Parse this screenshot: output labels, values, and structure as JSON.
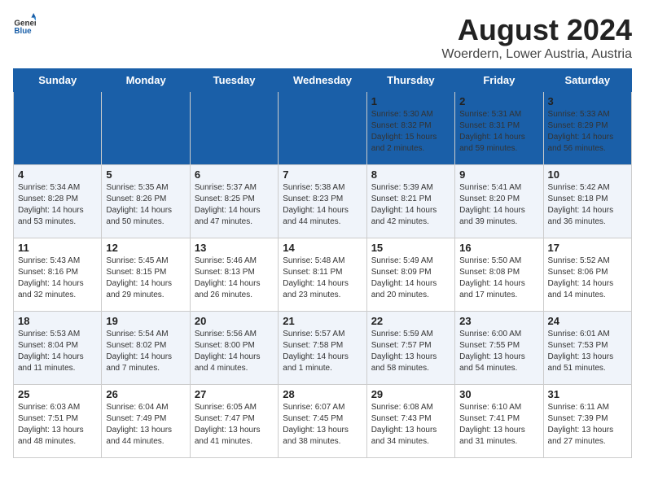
{
  "logo": {
    "text_general": "General",
    "text_blue": "Blue"
  },
  "title": "August 2024",
  "subtitle": "Woerdern, Lower Austria, Austria",
  "days": [
    "Sunday",
    "Monday",
    "Tuesday",
    "Wednesday",
    "Thursday",
    "Friday",
    "Saturday"
  ],
  "weeks": [
    [
      {
        "date": "",
        "info": ""
      },
      {
        "date": "",
        "info": ""
      },
      {
        "date": "",
        "info": ""
      },
      {
        "date": "",
        "info": ""
      },
      {
        "date": "1",
        "info": "Sunrise: 5:30 AM\nSunset: 8:32 PM\nDaylight: 15 hours\nand 2 minutes."
      },
      {
        "date": "2",
        "info": "Sunrise: 5:31 AM\nSunset: 8:31 PM\nDaylight: 14 hours\nand 59 minutes."
      },
      {
        "date": "3",
        "info": "Sunrise: 5:33 AM\nSunset: 8:29 PM\nDaylight: 14 hours\nand 56 minutes."
      }
    ],
    [
      {
        "date": "4",
        "info": "Sunrise: 5:34 AM\nSunset: 8:28 PM\nDaylight: 14 hours\nand 53 minutes."
      },
      {
        "date": "5",
        "info": "Sunrise: 5:35 AM\nSunset: 8:26 PM\nDaylight: 14 hours\nand 50 minutes."
      },
      {
        "date": "6",
        "info": "Sunrise: 5:37 AM\nSunset: 8:25 PM\nDaylight: 14 hours\nand 47 minutes."
      },
      {
        "date": "7",
        "info": "Sunrise: 5:38 AM\nSunset: 8:23 PM\nDaylight: 14 hours\nand 44 minutes."
      },
      {
        "date": "8",
        "info": "Sunrise: 5:39 AM\nSunset: 8:21 PM\nDaylight: 14 hours\nand 42 minutes."
      },
      {
        "date": "9",
        "info": "Sunrise: 5:41 AM\nSunset: 8:20 PM\nDaylight: 14 hours\nand 39 minutes."
      },
      {
        "date": "10",
        "info": "Sunrise: 5:42 AM\nSunset: 8:18 PM\nDaylight: 14 hours\nand 36 minutes."
      }
    ],
    [
      {
        "date": "11",
        "info": "Sunrise: 5:43 AM\nSunset: 8:16 PM\nDaylight: 14 hours\nand 32 minutes."
      },
      {
        "date": "12",
        "info": "Sunrise: 5:45 AM\nSunset: 8:15 PM\nDaylight: 14 hours\nand 29 minutes."
      },
      {
        "date": "13",
        "info": "Sunrise: 5:46 AM\nSunset: 8:13 PM\nDaylight: 14 hours\nand 26 minutes."
      },
      {
        "date": "14",
        "info": "Sunrise: 5:48 AM\nSunset: 8:11 PM\nDaylight: 14 hours\nand 23 minutes."
      },
      {
        "date": "15",
        "info": "Sunrise: 5:49 AM\nSunset: 8:09 PM\nDaylight: 14 hours\nand 20 minutes."
      },
      {
        "date": "16",
        "info": "Sunrise: 5:50 AM\nSunset: 8:08 PM\nDaylight: 14 hours\nand 17 minutes."
      },
      {
        "date": "17",
        "info": "Sunrise: 5:52 AM\nSunset: 8:06 PM\nDaylight: 14 hours\nand 14 minutes."
      }
    ],
    [
      {
        "date": "18",
        "info": "Sunrise: 5:53 AM\nSunset: 8:04 PM\nDaylight: 14 hours\nand 11 minutes."
      },
      {
        "date": "19",
        "info": "Sunrise: 5:54 AM\nSunset: 8:02 PM\nDaylight: 14 hours\nand 7 minutes."
      },
      {
        "date": "20",
        "info": "Sunrise: 5:56 AM\nSunset: 8:00 PM\nDaylight: 14 hours\nand 4 minutes."
      },
      {
        "date": "21",
        "info": "Sunrise: 5:57 AM\nSunset: 7:58 PM\nDaylight: 14 hours\nand 1 minute."
      },
      {
        "date": "22",
        "info": "Sunrise: 5:59 AM\nSunset: 7:57 PM\nDaylight: 13 hours\nand 58 minutes."
      },
      {
        "date": "23",
        "info": "Sunrise: 6:00 AM\nSunset: 7:55 PM\nDaylight: 13 hours\nand 54 minutes."
      },
      {
        "date": "24",
        "info": "Sunrise: 6:01 AM\nSunset: 7:53 PM\nDaylight: 13 hours\nand 51 minutes."
      }
    ],
    [
      {
        "date": "25",
        "info": "Sunrise: 6:03 AM\nSunset: 7:51 PM\nDaylight: 13 hours\nand 48 minutes."
      },
      {
        "date": "26",
        "info": "Sunrise: 6:04 AM\nSunset: 7:49 PM\nDaylight: 13 hours\nand 44 minutes."
      },
      {
        "date": "27",
        "info": "Sunrise: 6:05 AM\nSunset: 7:47 PM\nDaylight: 13 hours\nand 41 minutes."
      },
      {
        "date": "28",
        "info": "Sunrise: 6:07 AM\nSunset: 7:45 PM\nDaylight: 13 hours\nand 38 minutes."
      },
      {
        "date": "29",
        "info": "Sunrise: 6:08 AM\nSunset: 7:43 PM\nDaylight: 13 hours\nand 34 minutes."
      },
      {
        "date": "30",
        "info": "Sunrise: 6:10 AM\nSunset: 7:41 PM\nDaylight: 13 hours\nand 31 minutes."
      },
      {
        "date": "31",
        "info": "Sunrise: 6:11 AM\nSunset: 7:39 PM\nDaylight: 13 hours\nand 27 minutes."
      }
    ]
  ]
}
